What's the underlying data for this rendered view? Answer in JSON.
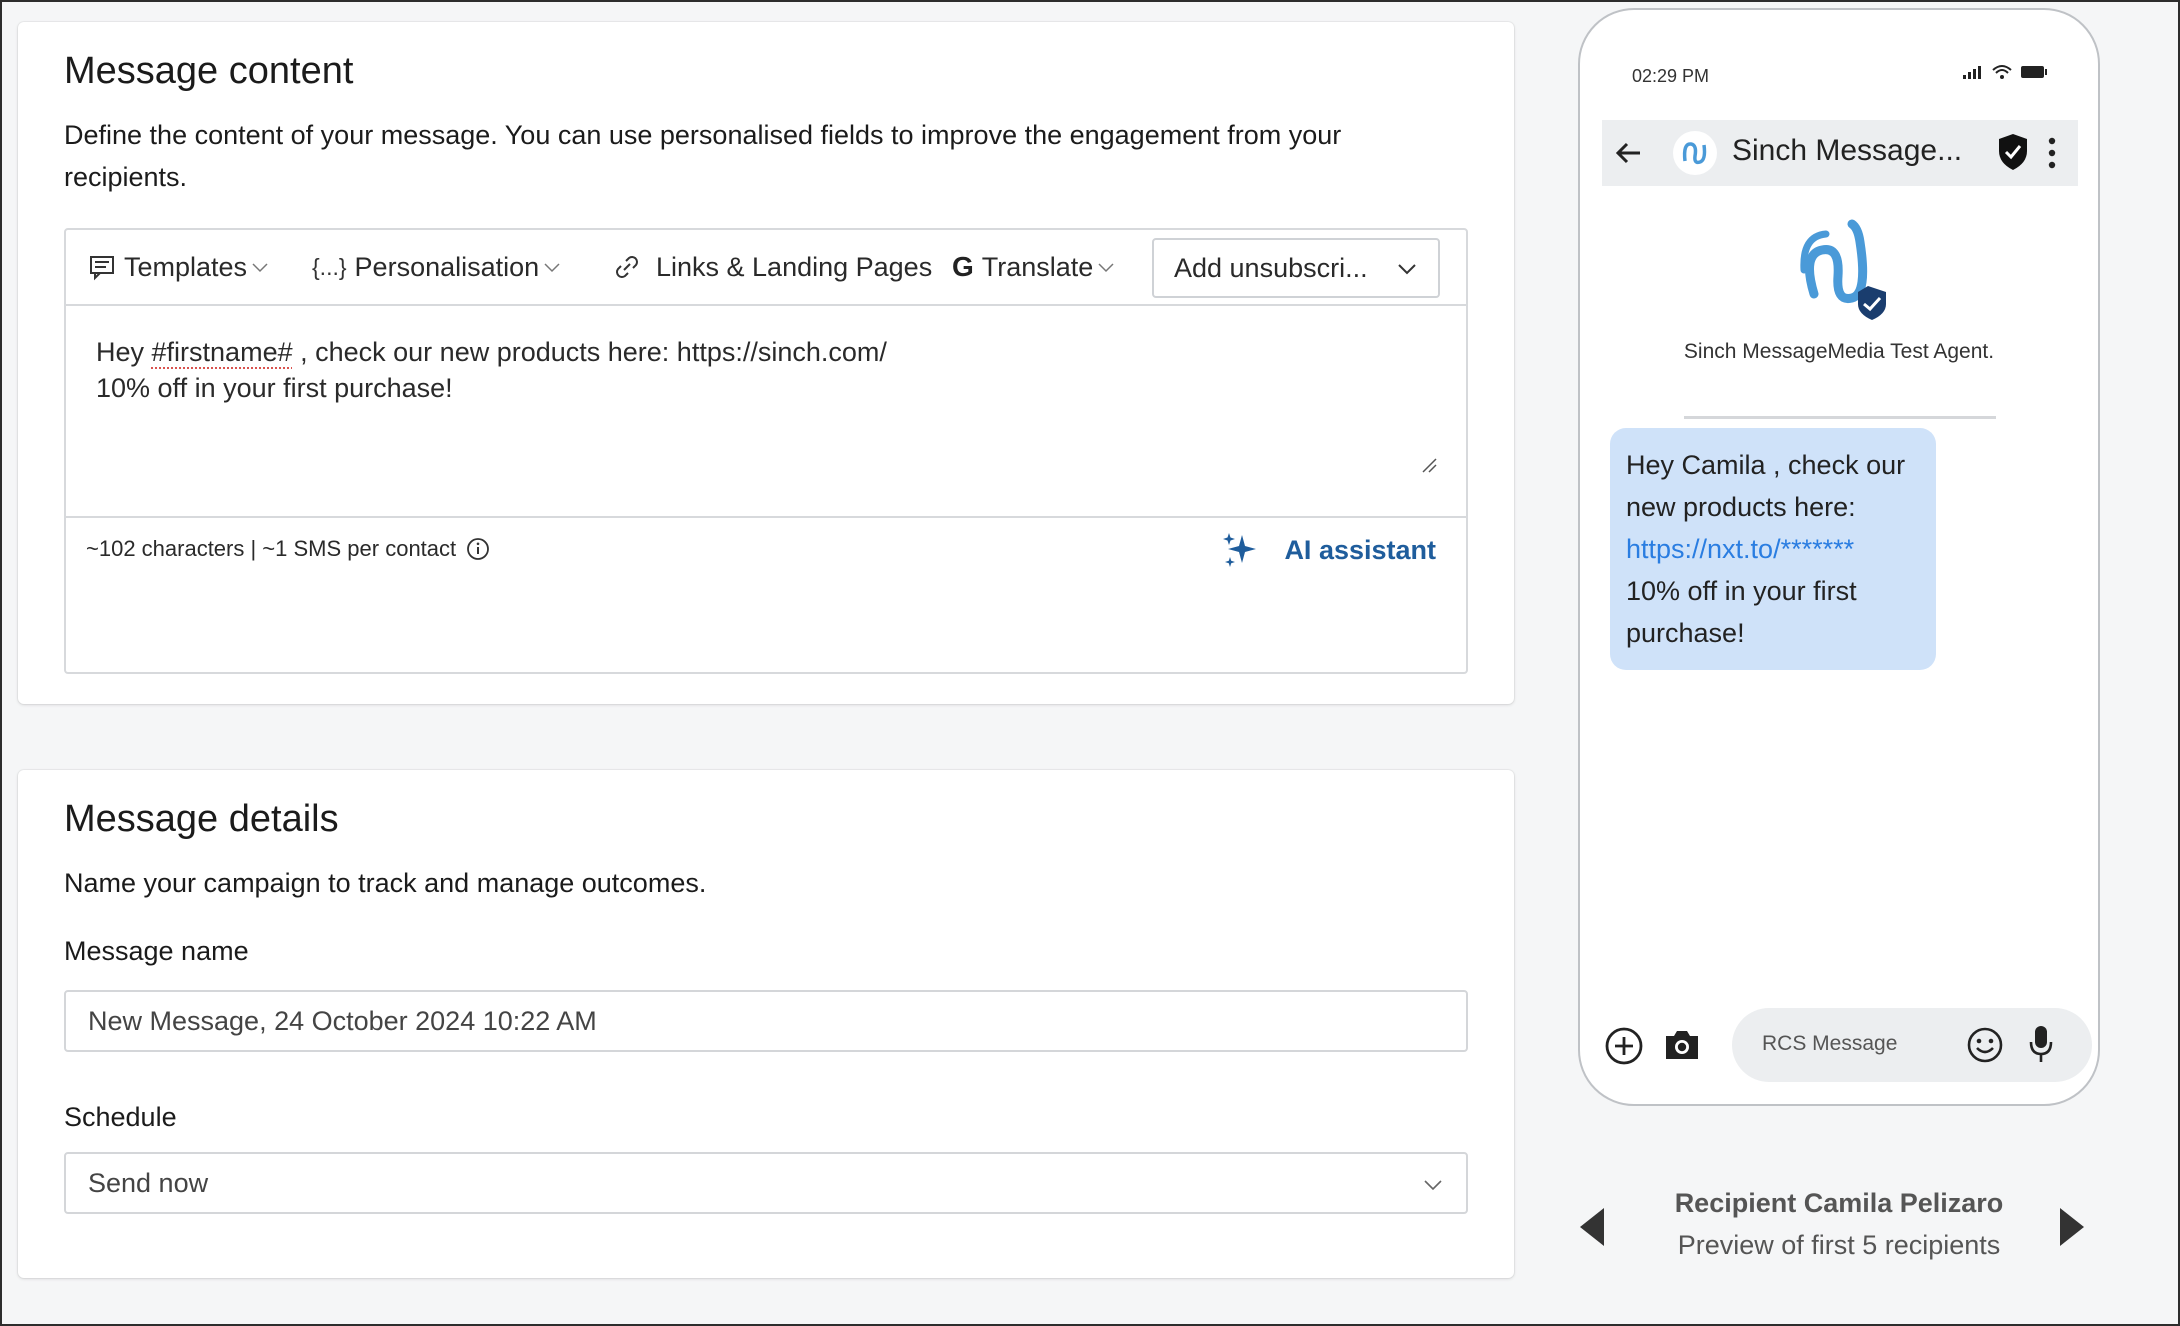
{
  "message_content": {
    "title": "Message content",
    "description": "Define the content of your message. You can use personalised fields to improve the engagement from your recipients.",
    "toolbar": {
      "templates": "Templates",
      "personalisation": "Personalisation",
      "links": "Links & Landing Pages",
      "translate": "Translate",
      "unsubscribe": "Add unsubscri..."
    },
    "body_line1_prefix": "Hey ",
    "body_token": "#firstname#",
    "body_line1_suffix": " , check our new products here: https://sinch.com/",
    "body_line2": "10% off in your first purchase!",
    "char_count": "~102 characters | ~1 SMS per contact",
    "ai_assistant": "AI assistant"
  },
  "message_details": {
    "title": "Message details",
    "description": "Name your campaign to track and manage outcomes.",
    "name_label": "Message name",
    "name_value": "New Message, 24 October 2024 10:22 AM",
    "schedule_label": "Schedule",
    "schedule_value": "Send now"
  },
  "phone_preview": {
    "time": "02:29 PM",
    "sender": "Sinch Message...",
    "agent_name": "Sinch MessageMedia Test Agent.",
    "bubble_line1": "Hey Camila , check our new products here:",
    "bubble_link": "https://nxt.to/*******",
    "bubble_line2": "10% off in your first purchase!",
    "compose_placeholder": "RCS Message"
  },
  "recipient_nav": {
    "name": "Recipient Camila Pelizaro",
    "subtitle": "Preview of first 5 recipients"
  },
  "colors": {
    "accent": "#1f5d9c",
    "bubble": "#cfe2f9",
    "link": "#2a7de1"
  }
}
